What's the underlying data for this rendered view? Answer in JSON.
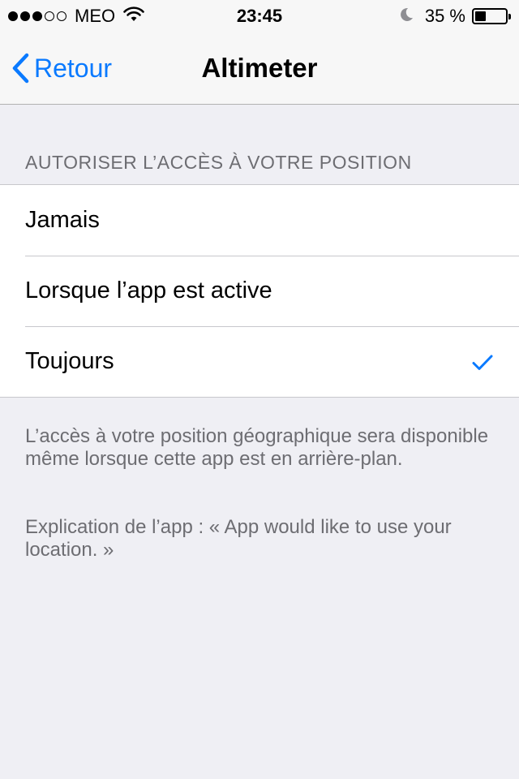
{
  "status_bar": {
    "signal": [
      "on",
      "on",
      "on",
      "off",
      "off"
    ],
    "carrier": "MEO",
    "time": "23:45",
    "battery_pct": "35 %",
    "battery_level": 0.35
  },
  "nav": {
    "back_label": "Retour",
    "title": "Altimeter"
  },
  "section": {
    "header": "AUTORISER L’ACCÈS À VOTRE POSITION",
    "options": [
      {
        "label": "Jamais",
        "selected": false
      },
      {
        "label": "Lorsque l’app est active",
        "selected": false
      },
      {
        "label": "Toujours",
        "selected": true
      }
    ],
    "footer_text": "L’accès à votre position géographique sera disponible même lorsque cette app est en arrière-plan.",
    "app_explanation": "Explication de l’app : « App would like to use your location. »"
  },
  "colors": {
    "accent": "#0a7aff",
    "background": "#efeff4",
    "secondary_text": "#6d6d72"
  }
}
